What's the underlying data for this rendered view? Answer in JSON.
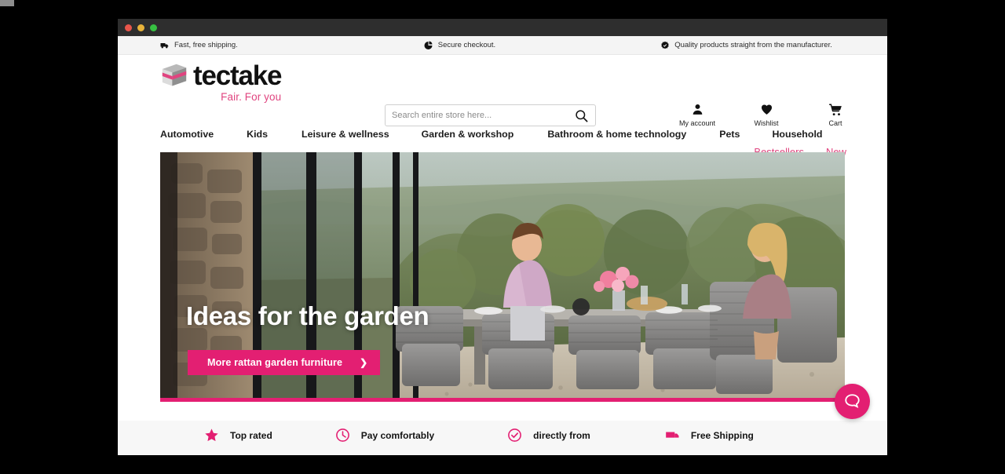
{
  "window": {
    "traffic_lights": [
      "close",
      "minimize",
      "zoom"
    ],
    "colors": {
      "close": "#e8564b",
      "minimize": "#e8b33a",
      "zoom": "#37c142"
    }
  },
  "theme": {
    "accent_pink": "#e31f72",
    "link_pink": "#e0447f",
    "text_dark": "#1d1d1d",
    "trustbar_bg": "#f4f4f4",
    "feature_bg": "#f7f7f7"
  },
  "trustbar": {
    "items": [
      {
        "icon": "truck-icon",
        "label": "Fast, free shipping."
      },
      {
        "icon": "pie-chart-icon",
        "label": "Secure checkout."
      },
      {
        "icon": "badge-check-icon",
        "label": "Quality products straight from the manufacturer."
      }
    ]
  },
  "header": {
    "logo": {
      "wordmark": "tectake",
      "tagline": "Fair. For you",
      "icon": "tectake-cube-icon"
    },
    "search": {
      "placeholder": "Search entire store here...",
      "value": "",
      "icon": "search-icon"
    },
    "utilities": [
      {
        "icon": "user-icon",
        "label": "My account"
      },
      {
        "icon": "heart-icon",
        "label": "Wishlist"
      },
      {
        "icon": "cart-icon",
        "label": "Cart"
      }
    ],
    "top_links": [
      {
        "label": "Bestsellers"
      },
      {
        "label": "New"
      }
    ]
  },
  "nav": {
    "items": [
      {
        "label": "Automotive"
      },
      {
        "label": "Kids"
      },
      {
        "label": "Leisure & wellness"
      },
      {
        "label": "Garden & workshop"
      },
      {
        "label": "Bathroom & home technology"
      },
      {
        "label": "Pets"
      },
      {
        "label": "Household"
      }
    ]
  },
  "hero": {
    "title": "Ideas for the garden",
    "cta_label": "More rattan garden furniture",
    "cta_chevron": "❯",
    "scene_description": "Couple dining at a grey rattan garden table on a terrace with olive trees and a valley view"
  },
  "features": {
    "items": [
      {
        "icon": "star-icon",
        "label": "Top rated"
      },
      {
        "icon": "clock-icon",
        "label": "Pay comfortably"
      },
      {
        "icon": "check-circle-icon",
        "label": "directly from"
      },
      {
        "icon": "shipping-box-icon",
        "label": "Free Shipping"
      }
    ]
  },
  "chat": {
    "icon": "chat-bubble-icon",
    "label": ""
  }
}
